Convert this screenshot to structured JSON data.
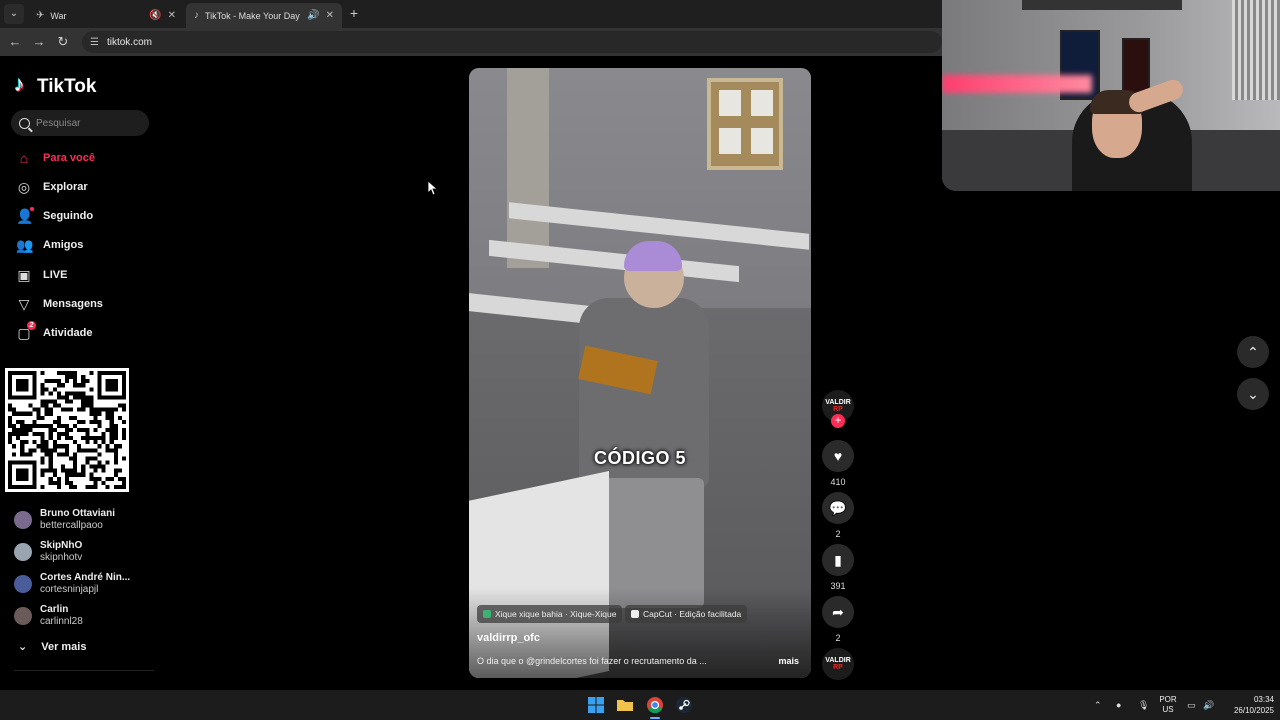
{
  "browser": {
    "tabs": [
      {
        "title": "War",
        "active": false
      },
      {
        "title": "TikTok - Make Your Day",
        "active": true
      }
    ],
    "url": "tiktok.com"
  },
  "sidebar": {
    "logo": "TikTok",
    "search_placeholder": "Pesquisar",
    "menu": [
      {
        "label": "Para você",
        "icon": "home-icon"
      },
      {
        "label": "Explorar",
        "icon": "compass-icon"
      },
      {
        "label": "Seguindo",
        "icon": "following-icon"
      },
      {
        "label": "Amigos",
        "icon": "friends-icon"
      },
      {
        "label": "LIVE",
        "icon": "live-icon"
      },
      {
        "label": "Mensagens",
        "icon": "send-icon"
      },
      {
        "label": "Atividade",
        "icon": "activity-icon",
        "badge": "2"
      }
    ],
    "accounts": [
      {
        "name": "Bruno Ottaviani",
        "handle": "bettercallpaoo"
      },
      {
        "name": "SkipNhO",
        "handle": "skipnhotv"
      },
      {
        "name": "Cortes André Nin...",
        "handle": "cortesninjapjl"
      },
      {
        "name": "Carlin",
        "handle": "carlinnl28"
      }
    ],
    "see_more": "Ver mais"
  },
  "video": {
    "caption": "CÓDIGO 5",
    "location_chip": "Xique xique bahia · Xique-Xique",
    "capcut_chip": "CapCut · Edição facilitada",
    "author": "valdirrp_ofc",
    "description": "O dia que o @grindelcortes foi fazer o recrutamento da ...",
    "more": "mais"
  },
  "actions": {
    "avatar_text_1": "VALDIR",
    "avatar_text_2": "RP",
    "likes": "410",
    "comments": "2",
    "saves": "391",
    "shares": "2"
  },
  "taskbar": {
    "lang_1": "POR",
    "lang_2": "US",
    "time": "03:34",
    "date": "26/10/2025"
  },
  "colors": {
    "accent": "#fe2c55",
    "background": "#000000"
  }
}
